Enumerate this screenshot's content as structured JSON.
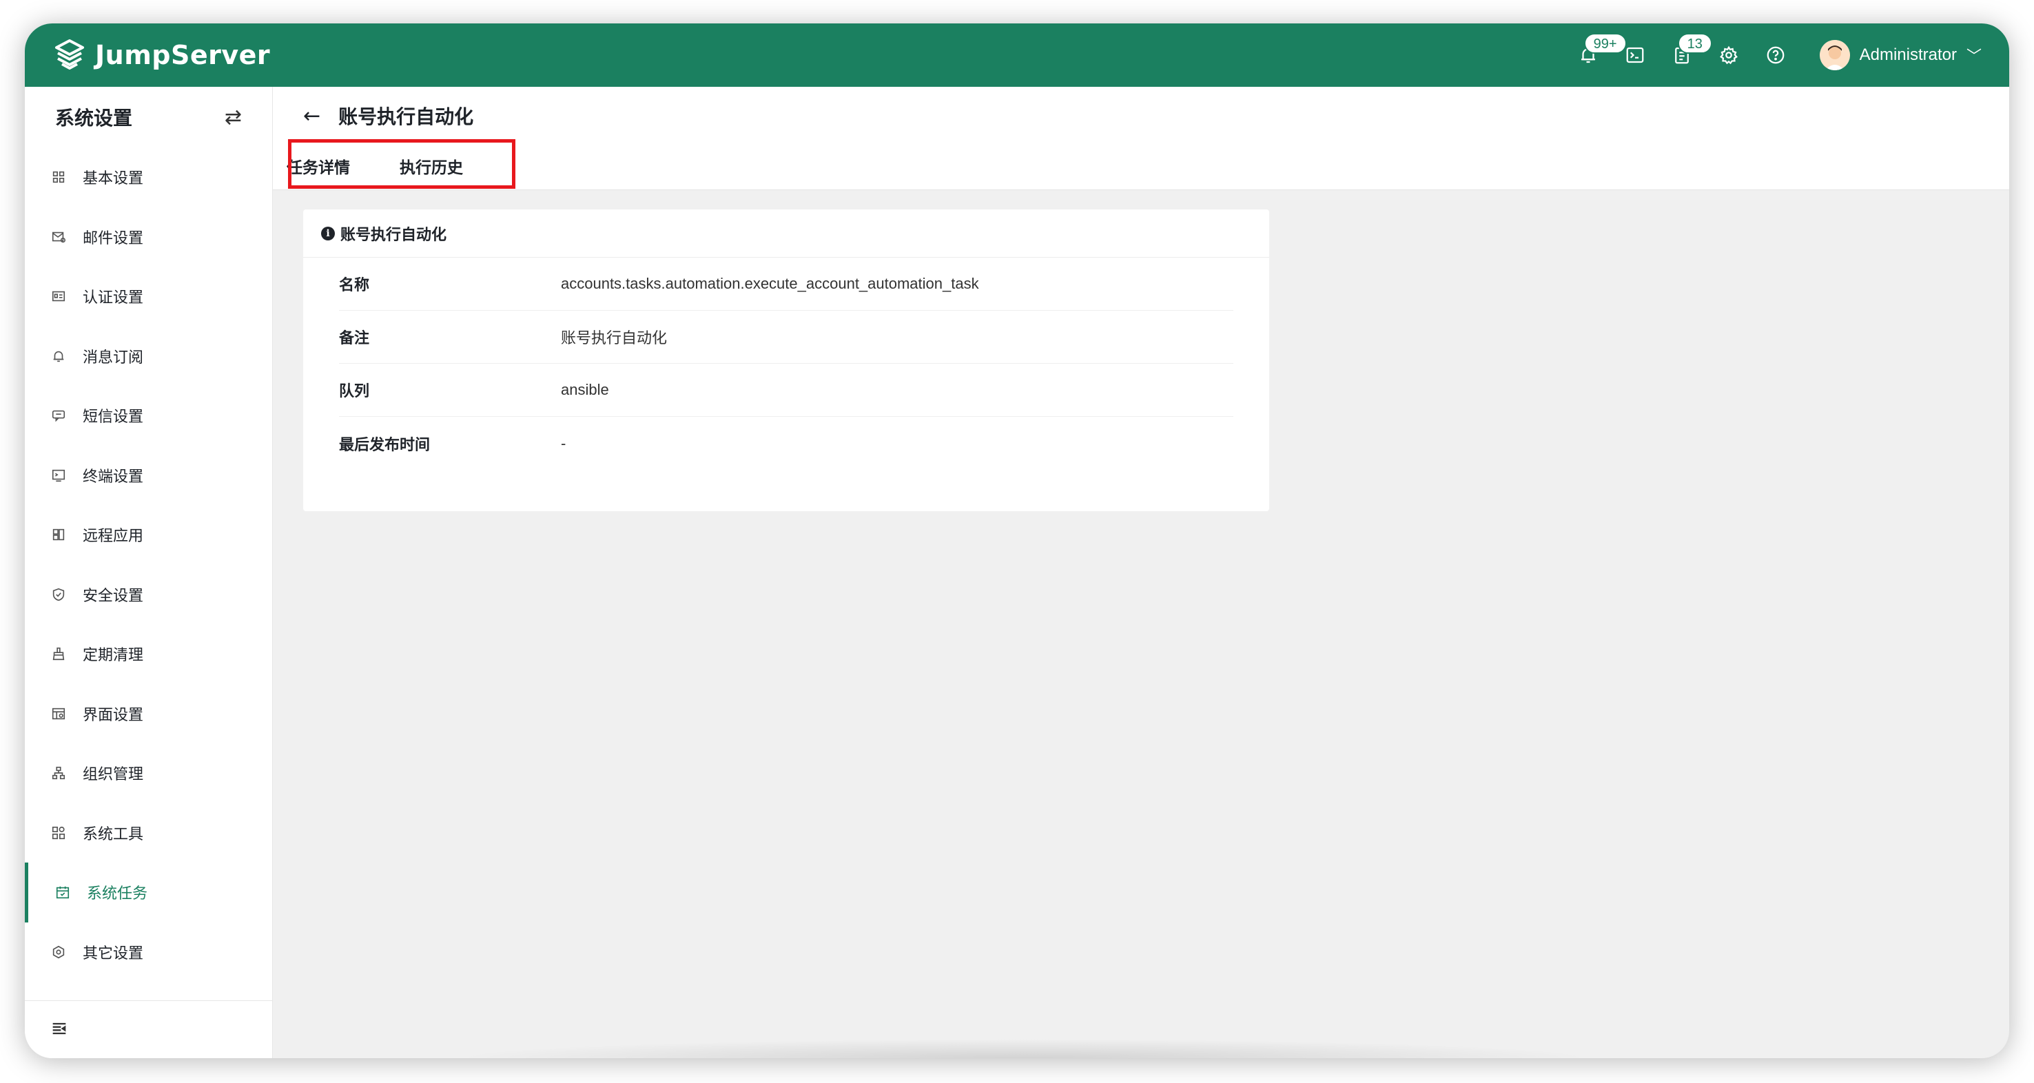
{
  "app": {
    "brand": "JumpServer"
  },
  "topbar": {
    "notifications_badge": "99+",
    "tickets_badge": "13",
    "user_name": "Administrator"
  },
  "sidebar": {
    "title": "系统设置",
    "items": [
      {
        "label": "基本设置",
        "icon": "grid-icon"
      },
      {
        "label": "邮件设置",
        "icon": "mail-settings-icon"
      },
      {
        "label": "认证设置",
        "icon": "id-card-icon"
      },
      {
        "label": "消息订阅",
        "icon": "bell-icon"
      },
      {
        "label": "短信设置",
        "icon": "message-icon"
      },
      {
        "label": "终端设置",
        "icon": "terminal-icon"
      },
      {
        "label": "远程应用",
        "icon": "app-icon"
      },
      {
        "label": "安全设置",
        "icon": "shield-icon"
      },
      {
        "label": "定期清理",
        "icon": "broom-icon"
      },
      {
        "label": "界面设置",
        "icon": "layout-icon"
      },
      {
        "label": "组织管理",
        "icon": "org-icon"
      },
      {
        "label": "系统工具",
        "icon": "tools-icon"
      },
      {
        "label": "系统任务",
        "icon": "calendar-icon",
        "active": true
      },
      {
        "label": "其它设置",
        "icon": "hexagon-gear-icon"
      }
    ]
  },
  "page": {
    "title": "账号执行自动化",
    "tabs": [
      "任务详情",
      "执行历史"
    ]
  },
  "card": {
    "title": "账号执行自动化",
    "rows": [
      {
        "label": "名称",
        "value": "accounts.tasks.automation.execute_account_automation_task"
      },
      {
        "label": "备注",
        "value": "账号执行自动化"
      },
      {
        "label": "队列",
        "value": "ansible"
      },
      {
        "label": "最后发布时间",
        "value": "-"
      }
    ]
  },
  "colors": {
    "brand": "#1b8060",
    "highlight": "#e8181d"
  }
}
